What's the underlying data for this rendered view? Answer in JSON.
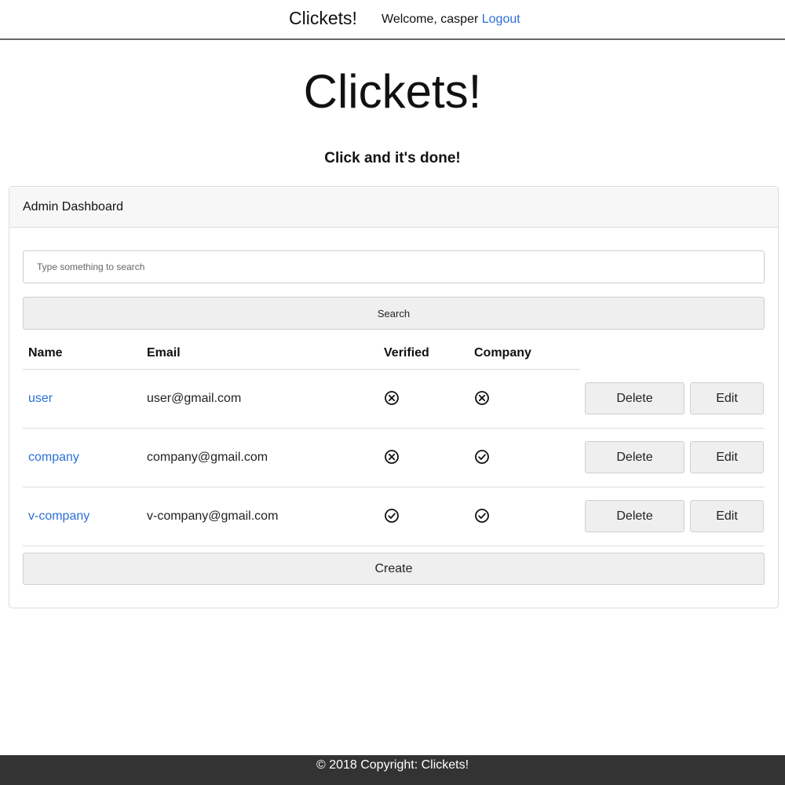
{
  "navbar": {
    "brand": "Clickets!",
    "welcome_text": "Welcome, casper ",
    "logout_label": "Logout"
  },
  "hero": {
    "title": "Clickets!",
    "tagline": "Click and it's done!"
  },
  "dashboard": {
    "header": "Admin Dashboard",
    "search_placeholder": "Type something to search",
    "search_value": "",
    "search_button": "Search",
    "columns": [
      "Name",
      "Email",
      "Verified",
      "Company"
    ],
    "rows": [
      {
        "name": "user",
        "email": "user@gmail.com",
        "verified": "x-circle-icon",
        "company": "x-circle-icon",
        "delete_label": "Delete",
        "edit_label": "Edit"
      },
      {
        "name": "company",
        "email": "company@gmail.com",
        "verified": "x-circle-icon",
        "company": "check-circle-icon",
        "delete_label": "Delete",
        "edit_label": "Edit"
      },
      {
        "name": "v-company",
        "email": "v-company@gmail.com",
        "verified": "check-circle-icon",
        "company": "check-circle-icon",
        "delete_label": "Delete",
        "edit_label": "Edit"
      }
    ],
    "create_button": "Create"
  },
  "footer": {
    "text": "© 2018 Copyright: Clickets!"
  },
  "colors": {
    "link": "#2a6fd6",
    "footer_bg": "#333333",
    "button_bg": "#efefef"
  }
}
